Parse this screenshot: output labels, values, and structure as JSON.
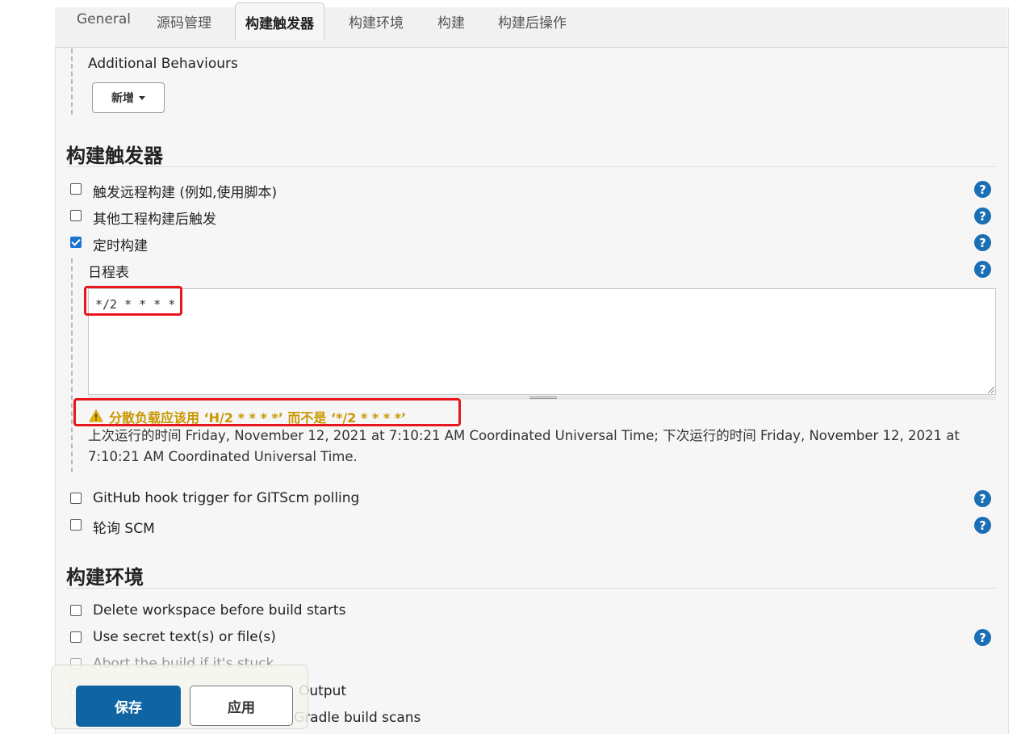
{
  "tabs": [
    {
      "label": "General"
    },
    {
      "label": "源码管理"
    },
    {
      "label": "构建触发器"
    },
    {
      "label": "构建环境"
    },
    {
      "label": "构建"
    },
    {
      "label": "构建后操作"
    }
  ],
  "scm": {
    "additional_behaviours_label": "Additional Behaviours",
    "add_button_label": "新增"
  },
  "triggers": {
    "title": "构建触发器",
    "items": [
      {
        "label": "触发远程构建 (例如,使用脚本)",
        "checked": false
      },
      {
        "label": "其他工程构建后触发",
        "checked": false
      },
      {
        "label": "定时构建",
        "checked": true
      },
      {
        "label": "GitHub hook trigger for GITScm polling",
        "checked": false
      },
      {
        "label": "轮询 SCM",
        "checked": false
      }
    ],
    "schedule_label": "日程表",
    "schedule_value": "*/2 * * * *",
    "warning": "分散负载应该用 ‘H/2 * * * *’ 而不是 ‘*/2 * * * *’",
    "run_info": "上次运行的时间 Friday, November 12, 2021 at 7:10:21 AM Coordinated Universal Time; 下次运行的时间 Friday, November 12, 2021 at 7:10:21 AM Coordinated Universal Time."
  },
  "build_env": {
    "title": "构建环境",
    "items": [
      {
        "label": "Delete workspace before build starts",
        "checked": false
      },
      {
        "label": "Use secret text(s) or file(s)",
        "checked": false
      },
      {
        "label": "Abort the build if it's stuck",
        "checked": false
      },
      {
        "label": "Output",
        "checked": false
      },
      {
        "label": "Gradle build scans",
        "checked": false
      }
    ]
  },
  "actions": {
    "save_label": "保存",
    "apply_label": "应用"
  },
  "icons": {
    "help": "help-icon",
    "warning": "warning-icon",
    "caret": "chevron-down-icon"
  },
  "colors": {
    "primary": "#0f65a3",
    "checkbox_checked": "#1a73d1",
    "help": "#1b6fb5",
    "warning": "#c99700",
    "highlight": "#e8151d"
  }
}
